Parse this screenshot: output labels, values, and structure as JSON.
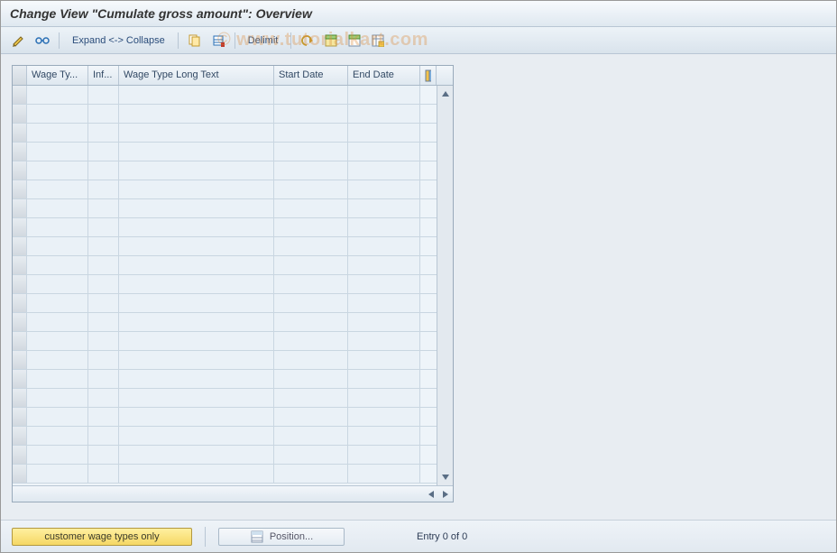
{
  "title": "Change View \"Cumulate gross amount\": Overview",
  "watermark": "© www.tutorialkart.com",
  "toolbar": {
    "expand_collapse_label": "Expand <-> Collapse",
    "delimit_label": "Delimit"
  },
  "table": {
    "columns": {
      "wage_type": "Wage Ty...",
      "inf": "Inf...",
      "long_text": "Wage Type Long Text",
      "start_date": "Start Date",
      "end_date": "End Date"
    },
    "rows": []
  },
  "bottom": {
    "customer_wage_label": "customer wage types only",
    "position_label": "Position...",
    "status": "Entry 0 of 0"
  }
}
